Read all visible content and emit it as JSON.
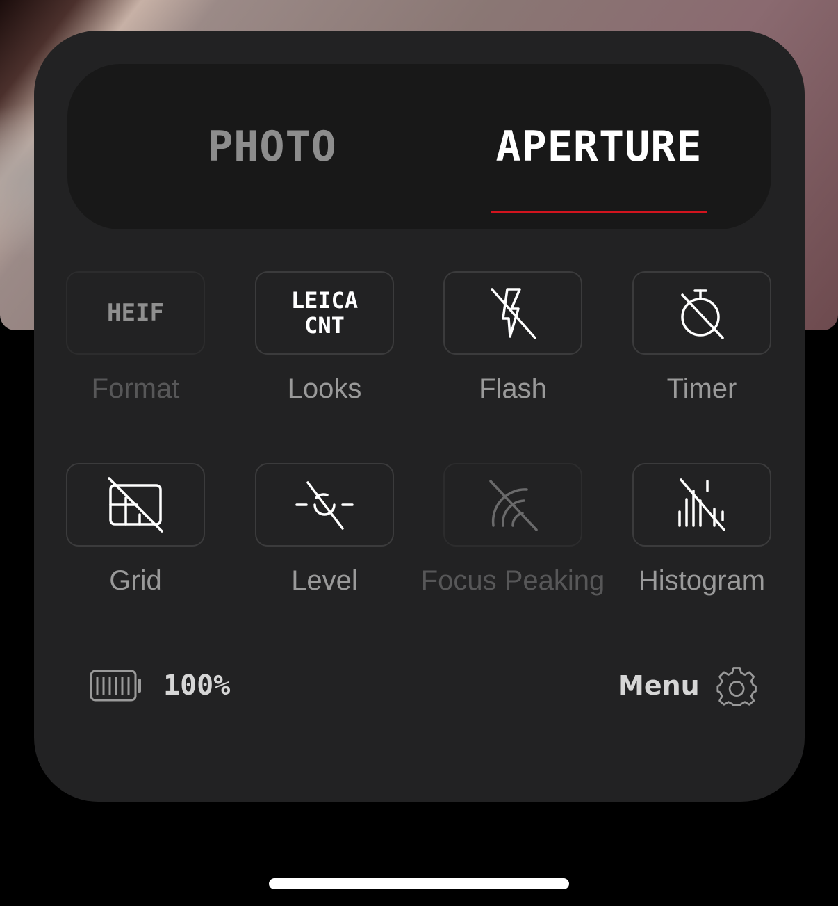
{
  "tabs": [
    {
      "label": "PHOTO",
      "active": false
    },
    {
      "label": "APERTURE",
      "active": true
    }
  ],
  "accent_color": "#d2141e",
  "controls": [
    {
      "label": "Format",
      "value": "HEIF",
      "enabled": false,
      "icon": "heif-text-icon"
    },
    {
      "label": "Looks",
      "value_line1": "LEICA",
      "value_line2": "CNT",
      "enabled": true,
      "icon": "leica-cnt-text-icon"
    },
    {
      "label": "Flash",
      "enabled": true,
      "icon": "flash-off-icon"
    },
    {
      "label": "Timer",
      "enabled": true,
      "icon": "timer-off-icon"
    },
    {
      "label": "Grid",
      "enabled": true,
      "icon": "grid-off-icon"
    },
    {
      "label": "Level",
      "enabled": true,
      "icon": "level-off-icon"
    },
    {
      "label": "Focus Peaking",
      "enabled": false,
      "icon": "focus-peaking-off-icon"
    },
    {
      "label": "Histogram",
      "enabled": true,
      "icon": "histogram-off-icon"
    }
  ],
  "status": {
    "battery_percent": "100%",
    "battery_level": 1.0
  },
  "menu": {
    "label": "Menu",
    "icon": "gear-icon"
  }
}
